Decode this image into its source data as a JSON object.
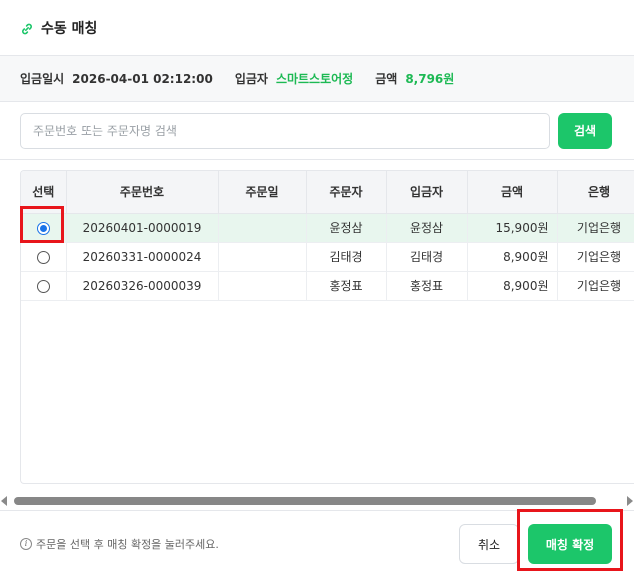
{
  "dialog": {
    "title": "수동 매칭",
    "icon": "link-icon"
  },
  "deposit_info": {
    "datetime_label": "입금일시",
    "datetime_value": "2026-04-01 02:12:00",
    "depositor_label": "입금자",
    "depositor_value": "스마트스토어정",
    "amount_label": "금액",
    "amount_value": "8,796원"
  },
  "search": {
    "placeholder": "주문번호 또는 주문자명 검색",
    "value": "",
    "button_label": "검색"
  },
  "table": {
    "headers": [
      "선택",
      "주문번호",
      "주문일",
      "주문자",
      "입금자",
      "금액",
      "은행"
    ],
    "rows": [
      {
        "selected": true,
        "order_no": "20260401-0000019",
        "order_date": "",
        "orderer": "윤정삼",
        "depositor": "윤정삼",
        "amount": "15,900원",
        "bank": "기업은행"
      },
      {
        "selected": false,
        "order_no": "20260331-0000024",
        "order_date": "",
        "orderer": "김태경",
        "depositor": "김태경",
        "amount": "8,900원",
        "bank": "기업은행"
      },
      {
        "selected": false,
        "order_no": "20260326-0000039",
        "order_date": "",
        "orderer": "홍정표",
        "depositor": "홍정표",
        "amount": "8,900원",
        "bank": "기업은행"
      }
    ]
  },
  "footer": {
    "hint": "주문을 선택 후 매칭 확정을 눌러주세요.",
    "cancel_label": "취소",
    "confirm_label": "매칭 확정"
  },
  "colors": {
    "accent": "#1cc66a",
    "highlight": "#e8151b",
    "selected_row": "#e8f6ee"
  }
}
